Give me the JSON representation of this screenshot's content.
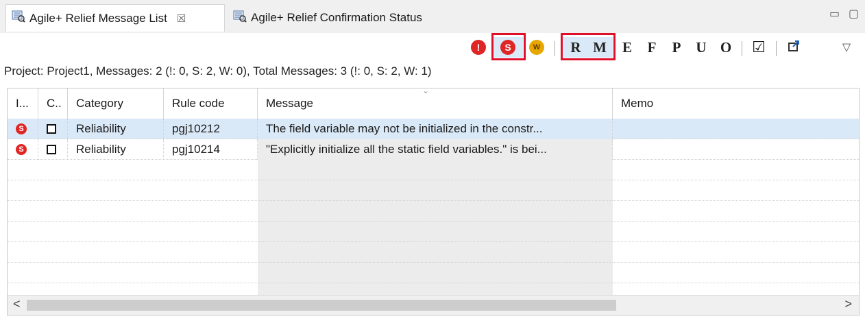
{
  "tabs": [
    {
      "label": "Agile+ Relief Message List",
      "active": true,
      "close": "☒"
    },
    {
      "label": "Agile+ Relief Confirmation Status",
      "active": false
    }
  ],
  "window_controls": {
    "minimize": "▭",
    "maximize": "▢"
  },
  "toolbar": {
    "severity_filters": [
      {
        "glyph": "!",
        "name": "error-filter",
        "color": "#e02525"
      },
      {
        "glyph": "S",
        "name": "s-filter",
        "color": "#e02525",
        "highlighted": true
      },
      {
        "glyph": "W",
        "name": "w-filter",
        "color": "#e6a800"
      }
    ],
    "category_filters": [
      {
        "glyph": "R",
        "highlighted": true
      },
      {
        "glyph": "M",
        "highlighted": true
      },
      {
        "glyph": "E"
      },
      {
        "glyph": "F"
      },
      {
        "glyph": "P"
      },
      {
        "glyph": "U"
      },
      {
        "glyph": "O"
      }
    ],
    "checkbox_glyph": "☑",
    "export_glyph": "🗗",
    "menu_glyph": "▽"
  },
  "status_line": "Project: Project1,  Messages: 2 (!: 0, S: 2, W: 0),  Total Messages: 3 (!: 0, S: 2, W: 1)",
  "table": {
    "columns": [
      "I...",
      "C..",
      "Category",
      "Rule code",
      "Message",
      "Memo"
    ],
    "sort_indicator": "⌄",
    "rows": [
      {
        "icon": "S",
        "checked": false,
        "category": "Reliability",
        "rule_code": "pgj10212",
        "message": "The field variable may not be initialized in the constr...",
        "memo": "",
        "selected": true
      },
      {
        "icon": "S",
        "checked": false,
        "category": "Reliability",
        "rule_code": "pgj10214",
        "message": "\"Explicitly initialize all the static field variables.\" is bei...",
        "memo": "",
        "selected": false
      }
    ]
  },
  "scrollbar": {
    "left_arrow": "<",
    "right_arrow": ">"
  },
  "colors": {
    "accent_red": "#e02525",
    "highlight_border": "#e0102a",
    "selection": "#dae9f7"
  }
}
